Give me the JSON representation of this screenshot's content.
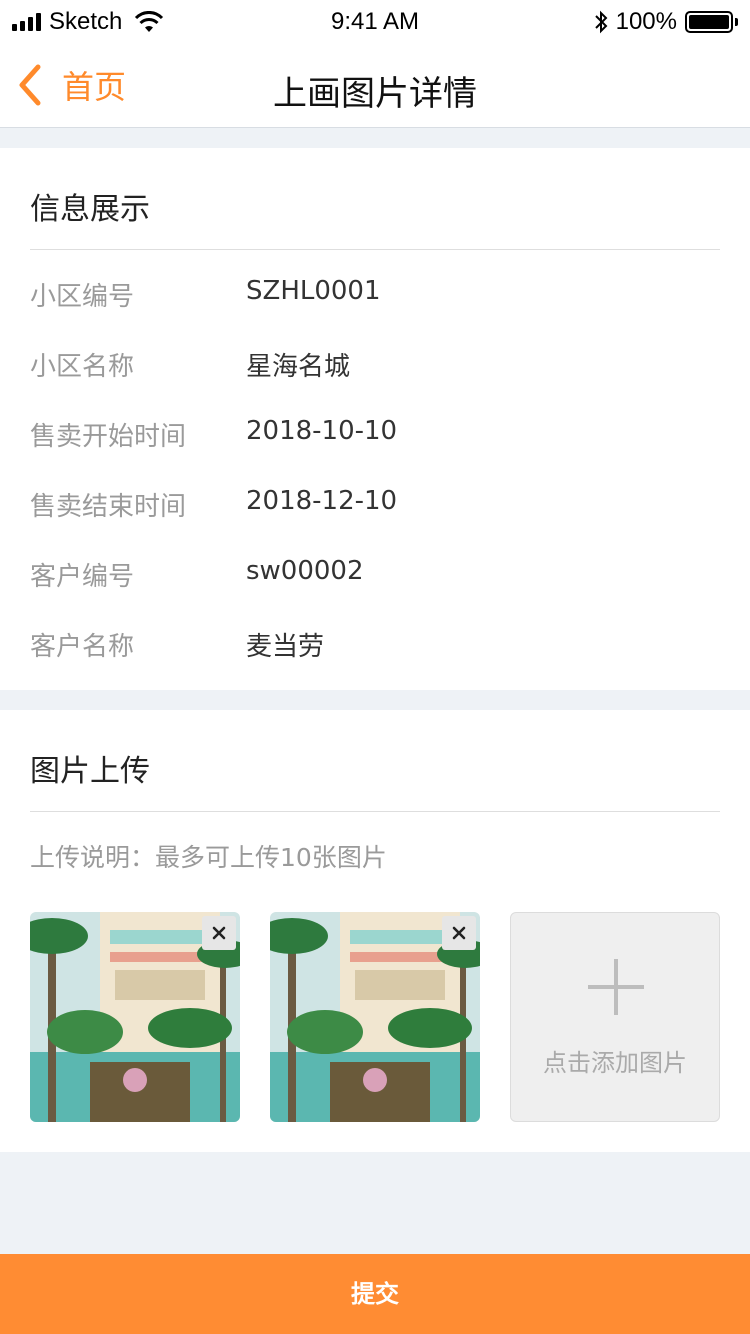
{
  "status_bar": {
    "carrier": "Sketch",
    "time": "9:41 AM",
    "battery": "100%",
    "signal_icon": "signal-icon",
    "wifi_icon": "wifi-icon",
    "bluetooth_icon": "bluetooth-icon",
    "battery_icon": "battery-icon"
  },
  "nav": {
    "back_label": "首页",
    "title": "上画图片详情",
    "back_icon": "chevron-left-icon"
  },
  "info_section": {
    "title": "信息展示",
    "rows": [
      {
        "label": "小区编号",
        "value": "SZHL0001"
      },
      {
        "label": "小区名称",
        "value": "星海名城"
      },
      {
        "label": "售卖开始时间",
        "value": "2018-10-10"
      },
      {
        "label": "售卖结束时间",
        "value": "2018-12-10"
      },
      {
        "label": "客户编号",
        "value": "sw00002"
      },
      {
        "label": "客户名称",
        "value": "麦当劳"
      }
    ]
  },
  "upload_section": {
    "title": "图片上传",
    "note": "上传说明：最多可上传10张图片",
    "remove_label": "x",
    "add_label": "点击添加图片",
    "add_icon": "plus-icon"
  },
  "submit": {
    "label": "提交"
  },
  "colors": {
    "accent": "#ff8a2b",
    "submit_bg": "#ff8c33",
    "page_bg": "#eef2f6"
  }
}
